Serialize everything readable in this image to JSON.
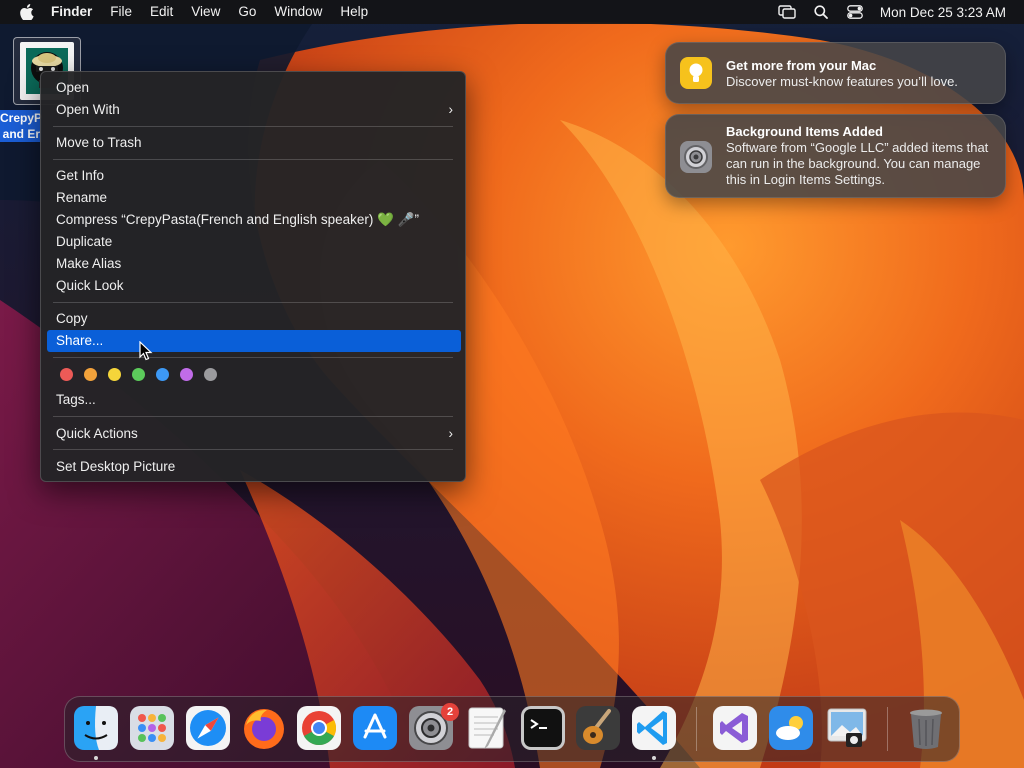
{
  "menubar": {
    "app_name": "Finder",
    "menus": [
      "File",
      "Edit",
      "View",
      "Go",
      "Window",
      "Help"
    ],
    "clock": "Mon Dec 25  3:23 AM"
  },
  "desktop_file": {
    "label_line1": "CrepyPa",
    "label_line2": " and Er"
  },
  "context_menu": {
    "open": "Open",
    "open_with": "Open With",
    "move_to_trash": "Move to Trash",
    "get_info": "Get Info",
    "rename": "Rename",
    "compress": "Compress “CrepyPasta(French and English speaker) 💚 🎤”",
    "duplicate": "Duplicate",
    "make_alias": "Make Alias",
    "quick_look": "Quick Look",
    "copy": "Copy",
    "share": "Share...",
    "tags": "Tags...",
    "quick_actions": "Quick Actions",
    "set_desktop_picture": "Set Desktop Picture",
    "chevron": "›",
    "tag_colors": [
      "#ec5a57",
      "#f2a23b",
      "#f5d53a",
      "#5ccb5b",
      "#3d99f5",
      "#c16ce9",
      "#9b9b9e"
    ]
  },
  "notifications": [
    {
      "title": "Get more from your Mac",
      "body": "Discover must-know features you’ll love."
    },
    {
      "title": "Background Items Added",
      "body": "Software from “Google LLC” added items that can run in the background. You can manage this in Login Items Settings."
    }
  ],
  "dock": {
    "apps": [
      "finder-icon",
      "launchpad-icon",
      "safari-icon",
      "firefox-icon",
      "chrome-icon",
      "app-store-icon",
      "system-settings-icon",
      "textedit-icon",
      "terminal-icon",
      "garageband-icon",
      "vscode-icon",
      "visual-studio-icon",
      "weather-icon",
      "preview-icon",
      "trash-icon"
    ],
    "system_settings_badge": "2"
  },
  "colors": {
    "accent": "#0a5fd8",
    "menu_bg": "#242426",
    "badge": "#e5423b"
  }
}
